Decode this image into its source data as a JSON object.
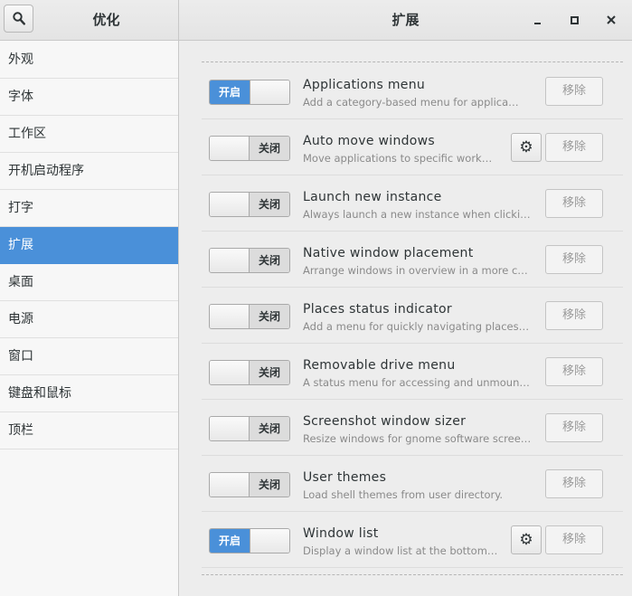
{
  "window": {
    "left_title": "优化",
    "main_title": "扩展",
    "search_icon": "search-icon",
    "minimize_icon": "minimize-icon",
    "maximize_icon": "maximize-icon",
    "close_icon": "close-icon"
  },
  "sidebar": {
    "items": [
      {
        "label": "外观",
        "active": false
      },
      {
        "label": "字体",
        "active": false
      },
      {
        "label": "工作区",
        "active": false
      },
      {
        "label": "开机启动程序",
        "active": false
      },
      {
        "label": "打字",
        "active": false
      },
      {
        "label": "扩展",
        "active": true
      },
      {
        "label": "桌面",
        "active": false
      },
      {
        "label": "电源",
        "active": false
      },
      {
        "label": "窗口",
        "active": false
      },
      {
        "label": "键盘和鼠标",
        "active": false
      },
      {
        "label": "顶栏",
        "active": false
      }
    ]
  },
  "extensions": [
    {
      "name": "Applications menu",
      "description": "Add a category-based menu for applications.",
      "enabled": true,
      "state_label": "开启",
      "has_settings": false,
      "remove_label": "移除"
    },
    {
      "name": "Auto move windows",
      "description": "Move applications to specific workspaces when they create windows.",
      "enabled": false,
      "state_label": "关闭",
      "has_settings": true,
      "remove_label": "移除"
    },
    {
      "name": "Launch new instance",
      "description": "Always launch a new instance when clicking in the dash or the application view.",
      "enabled": false,
      "state_label": "关闭",
      "has_settings": false,
      "remove_label": "移除"
    },
    {
      "name": "Native window placement",
      "description": "Arrange windows in overview in a more compact way.",
      "enabled": false,
      "state_label": "关闭",
      "has_settings": false,
      "remove_label": "移除"
    },
    {
      "name": "Places status indicator",
      "description": "Add a menu for quickly navigating places in the system.",
      "enabled": false,
      "state_label": "关闭",
      "has_settings": false,
      "remove_label": "移除"
    },
    {
      "name": "Removable drive menu",
      "description": "A status menu for accessing and unmounting removable devices.",
      "enabled": false,
      "state_label": "关闭",
      "has_settings": false,
      "remove_label": "移除"
    },
    {
      "name": "Screenshot window sizer",
      "description": "Resize windows for gnome software screenshots",
      "enabled": false,
      "state_label": "关闭",
      "has_settings": false,
      "remove_label": "移除"
    },
    {
      "name": "User themes",
      "description": "Load shell themes from user directory.",
      "enabled": false,
      "state_label": "关闭",
      "has_settings": false,
      "remove_label": "移除"
    },
    {
      "name": "Window list",
      "description": "Display a window list at the bottom of the screen.",
      "enabled": true,
      "state_label": "开启",
      "has_settings": true,
      "remove_label": "移除"
    }
  ],
  "colors": {
    "accent": "#4a90d9",
    "background": "#ededed",
    "sidebar_bg": "#f7f7f7",
    "text": "#2e3436",
    "muted_text": "#8a8a8a"
  }
}
